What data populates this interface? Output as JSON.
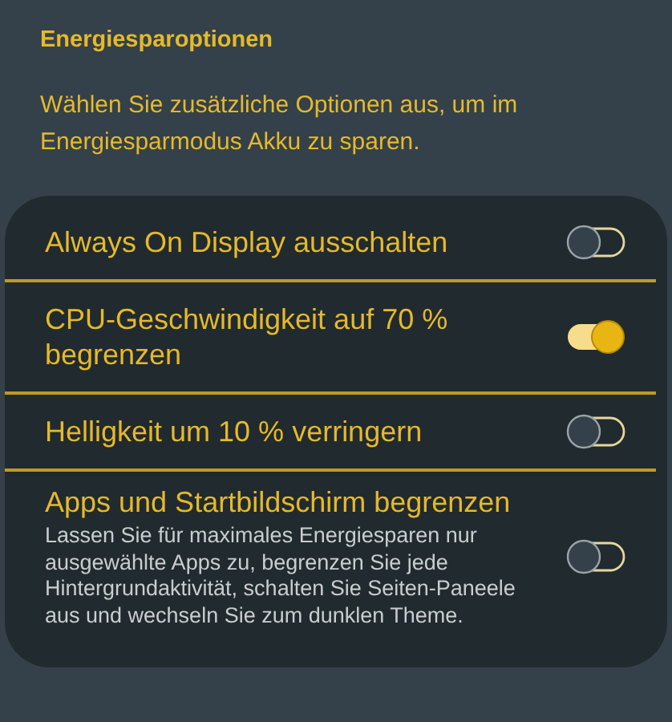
{
  "header": {
    "title": "Energiesparoptionen",
    "description": "Wählen Sie zusätzliche Optionen aus, um im Energiesparmodus Akku zu sparen."
  },
  "options": [
    {
      "label": "Always On Display ausschalten",
      "on": false
    },
    {
      "label": "CPU-Geschwindigkeit auf 70 % begrenzen",
      "on": true
    },
    {
      "label": "Helligkeit um 10 % verringern",
      "on": false
    },
    {
      "label": "Apps und Startbildschirm begrenzen",
      "description": "Lassen Sie für maximales Energiesparen nur ausgewählte Apps zu, begrenzen Sie jede Hintergrundaktivität, schalten Sie Seiten-Paneele aus und wechseln Sie zum dunklen Theme.",
      "on": false
    }
  ]
}
